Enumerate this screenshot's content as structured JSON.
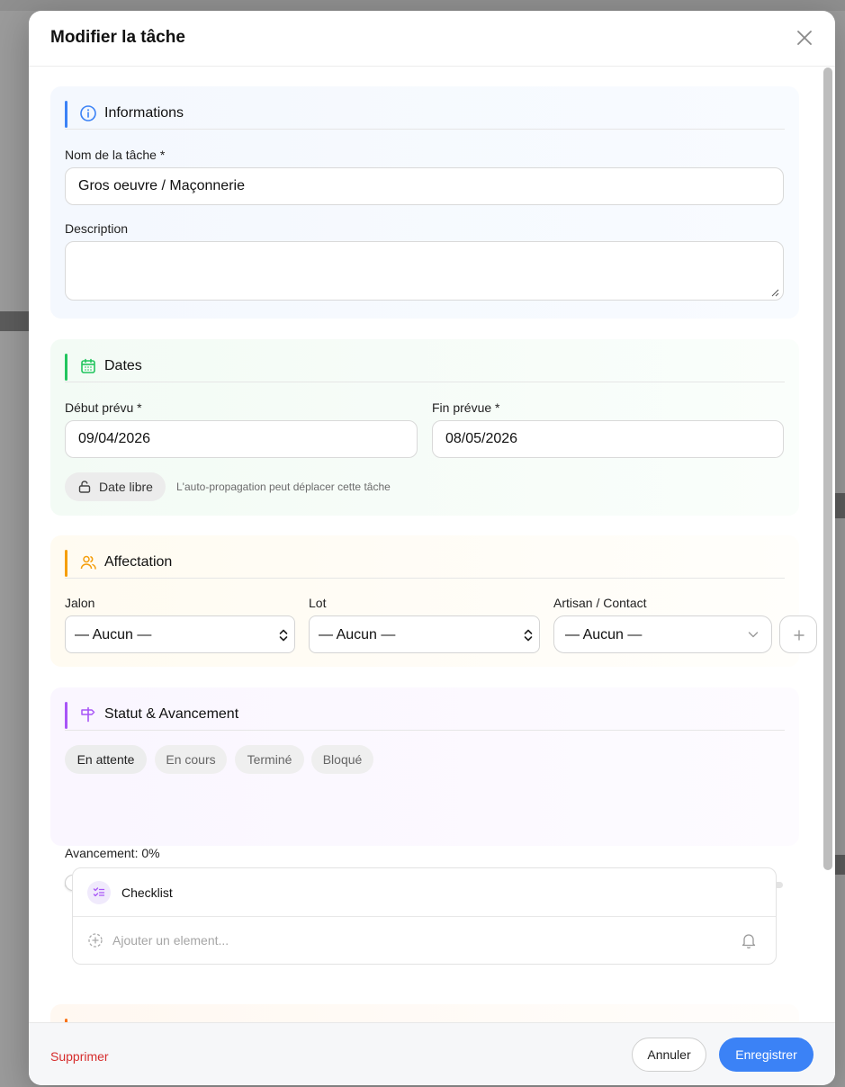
{
  "modal": {
    "title": "Modifier la tâche"
  },
  "sections": {
    "informations": {
      "title": "Informations",
      "name_label": "Nom de la tâche *",
      "name_value": "Gros oeuvre / Maçonnerie",
      "description_label": "Description",
      "description_value": ""
    },
    "dates": {
      "title": "Dates",
      "start_label": "Début prévu *",
      "start_value": "09/04/2026",
      "end_label": "Fin prévue *",
      "end_value": "08/05/2026",
      "lock_label": "Date libre",
      "lock_hint": "L'auto-propagation peut déplacer cette tâche"
    },
    "affectation": {
      "title": "Affectation",
      "jalon_label": "Jalon",
      "jalon_value": "— Aucun —",
      "lot_label": "Lot",
      "lot_value": "— Aucun —",
      "artisan_label": "Artisan / Contact",
      "artisan_value": "— Aucun —"
    },
    "status": {
      "title": "Statut & Avancement",
      "options": [
        "En attente",
        "En cours",
        "Terminé",
        "Bloqué"
      ],
      "selected": "En attente",
      "progress_label": "Avancement: 0%",
      "progress_value": 0
    }
  },
  "checklist": {
    "title": "Checklist",
    "placeholder": "Ajouter un element..."
  },
  "footer": {
    "delete_label": "Supprimer",
    "cancel_label": "Annuler",
    "save_label": "Enregistrer"
  },
  "colors": {
    "accent": "#3b82f6",
    "informations": "#3b82f6",
    "dates": "#22c55e",
    "affectation": "#f59e0b",
    "status": "#a855f7",
    "next_section": "#f97316",
    "danger": "#d62d2d"
  },
  "icons": {
    "close": "close-icon",
    "informations": "info-icon",
    "dates": "calendar-icon",
    "affectation": "users-icon",
    "status": "signpost-icon",
    "lock": "unlock-icon",
    "checklist": "list-checks-icon",
    "add_item": "add-circle-icon",
    "reminder": "bell-icon",
    "add_contact": "plus-icon"
  }
}
